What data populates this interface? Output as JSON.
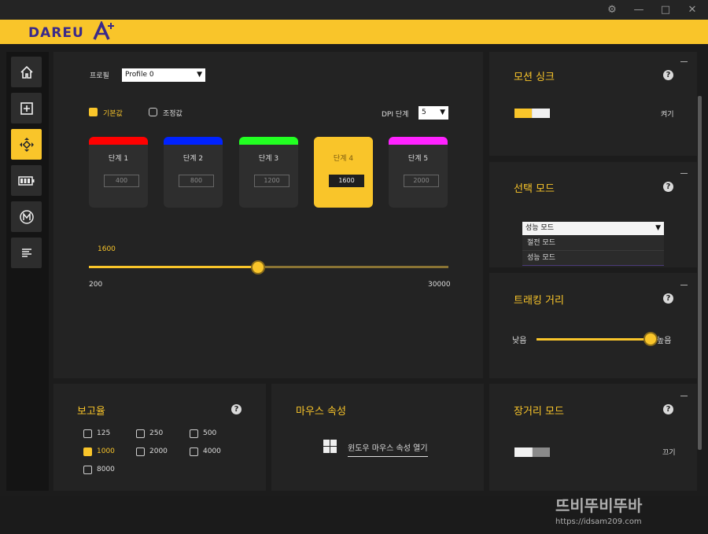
{
  "window": {
    "settings_glyph": "⚙",
    "minimize_glyph": "—",
    "maximize_glyph": "□",
    "close_glyph": "✕"
  },
  "brand": {
    "logo_text": "DAREU",
    "accent": "#f9c52a"
  },
  "sidebar": {
    "items": [
      {
        "icon": "home-icon",
        "active": false
      },
      {
        "icon": "plus-square-icon",
        "active": false
      },
      {
        "icon": "move-crosshair-icon",
        "active": true
      },
      {
        "icon": "battery-icon",
        "active": false
      },
      {
        "icon": "macro-m-icon",
        "active": false
      },
      {
        "icon": "text-lines-icon",
        "active": false
      }
    ]
  },
  "dpi": {
    "profile_label": "프로필",
    "profile_value": "Profile 0",
    "default_label": "기본값",
    "custom_label": "조정값",
    "default_checked": true,
    "custom_checked": false,
    "stage_count_label": "DPI 단계",
    "stage_count_value": "5",
    "stages": [
      {
        "name": "단계  1",
        "value": "400",
        "color": "#ff0000",
        "selected": false
      },
      {
        "name": "단계  2",
        "value": "800",
        "color": "#0022ff",
        "selected": false
      },
      {
        "name": "단계  3",
        "value": "1200",
        "color": "#22ff22",
        "selected": false
      },
      {
        "name": "단계  4",
        "value": "1600",
        "color": "#f9c52a",
        "selected": true
      },
      {
        "name": "단계  5",
        "value": "2000",
        "color": "#ff22ff",
        "selected": false
      }
    ],
    "slider_value_label": "1600",
    "slider_value": 1600,
    "slider_min_label": "200",
    "slider_max_label": "30000",
    "slider_min": 200,
    "slider_max": 30000
  },
  "report_rate": {
    "title": "보고율",
    "options": [
      {
        "label": "125",
        "checked": false
      },
      {
        "label": "250",
        "checked": false
      },
      {
        "label": "500",
        "checked": false
      },
      {
        "label": "1000",
        "checked": true
      },
      {
        "label": "2000",
        "checked": false
      },
      {
        "label": "4000",
        "checked": false
      },
      {
        "label": "8000",
        "checked": false
      }
    ]
  },
  "mouse_props": {
    "title": "마우스 속성",
    "link_label": "윈도우 마우스 속성 열기"
  },
  "motion_sync": {
    "title": "모션 싱크",
    "state_label": "켜기",
    "on": true
  },
  "select_mode": {
    "title": "선택 모드",
    "selected": "성능 모드",
    "options": [
      "절전 모드",
      "성능 모드"
    ]
  },
  "tracking": {
    "title": "트래킹 거리",
    "low_label": "낮음",
    "high_label": "높음",
    "level_percent": 100
  },
  "long_range": {
    "title": "장거리 모드",
    "state_label": "끄기",
    "on": false
  },
  "watermark": {
    "text": "뜨비뚜비뚜바",
    "url": "https://idsam209.com"
  }
}
